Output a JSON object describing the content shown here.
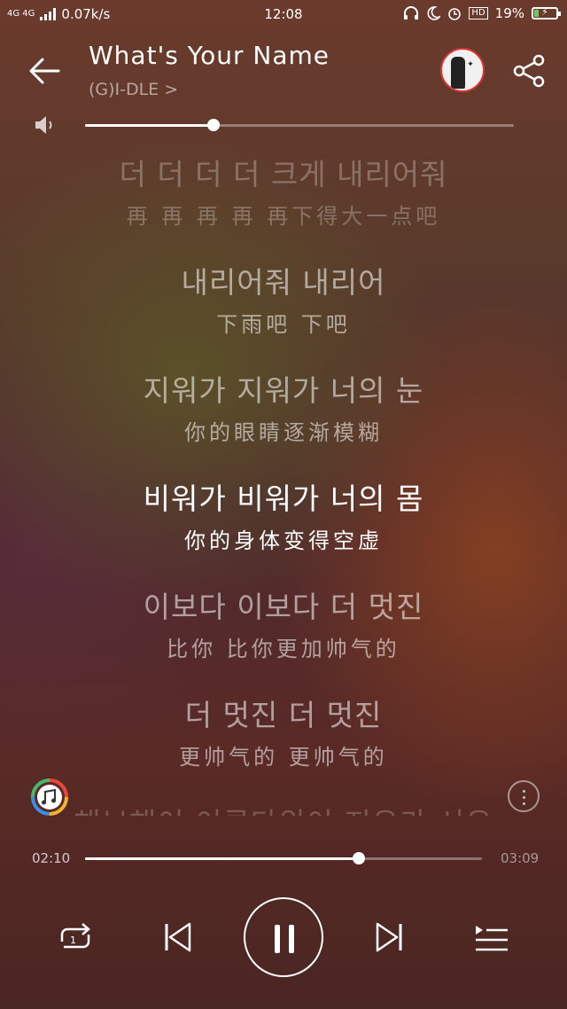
{
  "status_bar": {
    "network_label": "4G 4G",
    "speed": "0.07k/s",
    "time": "12:08",
    "battery": "19%",
    "battery_level": 0.19,
    "icons": [
      "signal-icon",
      "headset-icon",
      "moon-icon",
      "alarm-icon",
      "hd-icon",
      "battery-icon"
    ]
  },
  "header": {
    "title": "What's Your Name",
    "artist": "(G)I-DLE >"
  },
  "volume": {
    "level": 0.3
  },
  "lyrics": [
    {
      "ko": "더 더 더 더 크게 내리어줘",
      "zh": "再 再 再 再 再下得大一点吧",
      "state": "dim"
    },
    {
      "ko": "내리어줘 내리어",
      "zh": "下雨吧 下吧",
      "state": "normal"
    },
    {
      "ko": "지워가 지워가 너의 눈",
      "zh": "你的眼睛逐渐模糊",
      "state": "normal"
    },
    {
      "ko": "비워가 비워가 너의 몸",
      "zh": "你的身体变得空虚",
      "state": "active"
    },
    {
      "ko": "이보다 이보다 더 멋진",
      "zh": "比你 比你更加帅气的",
      "state": "normal"
    },
    {
      "ko": "더 멋진 더 멋진",
      "zh": "更帅气的 更帅气的",
      "state": "normal"
    },
    {
      "ko": "해보해이 이루다워이 지우가 시우",
      "zh": "",
      "state": "faded"
    }
  ],
  "playback": {
    "current_time": "02:10",
    "total_time": "03:09",
    "progress": 0.69
  },
  "colors": {
    "active_lyric": "#ffffff",
    "normal_lyric": "rgba(255,255,255,0.55)",
    "battery_fill": "#5cd35c"
  }
}
